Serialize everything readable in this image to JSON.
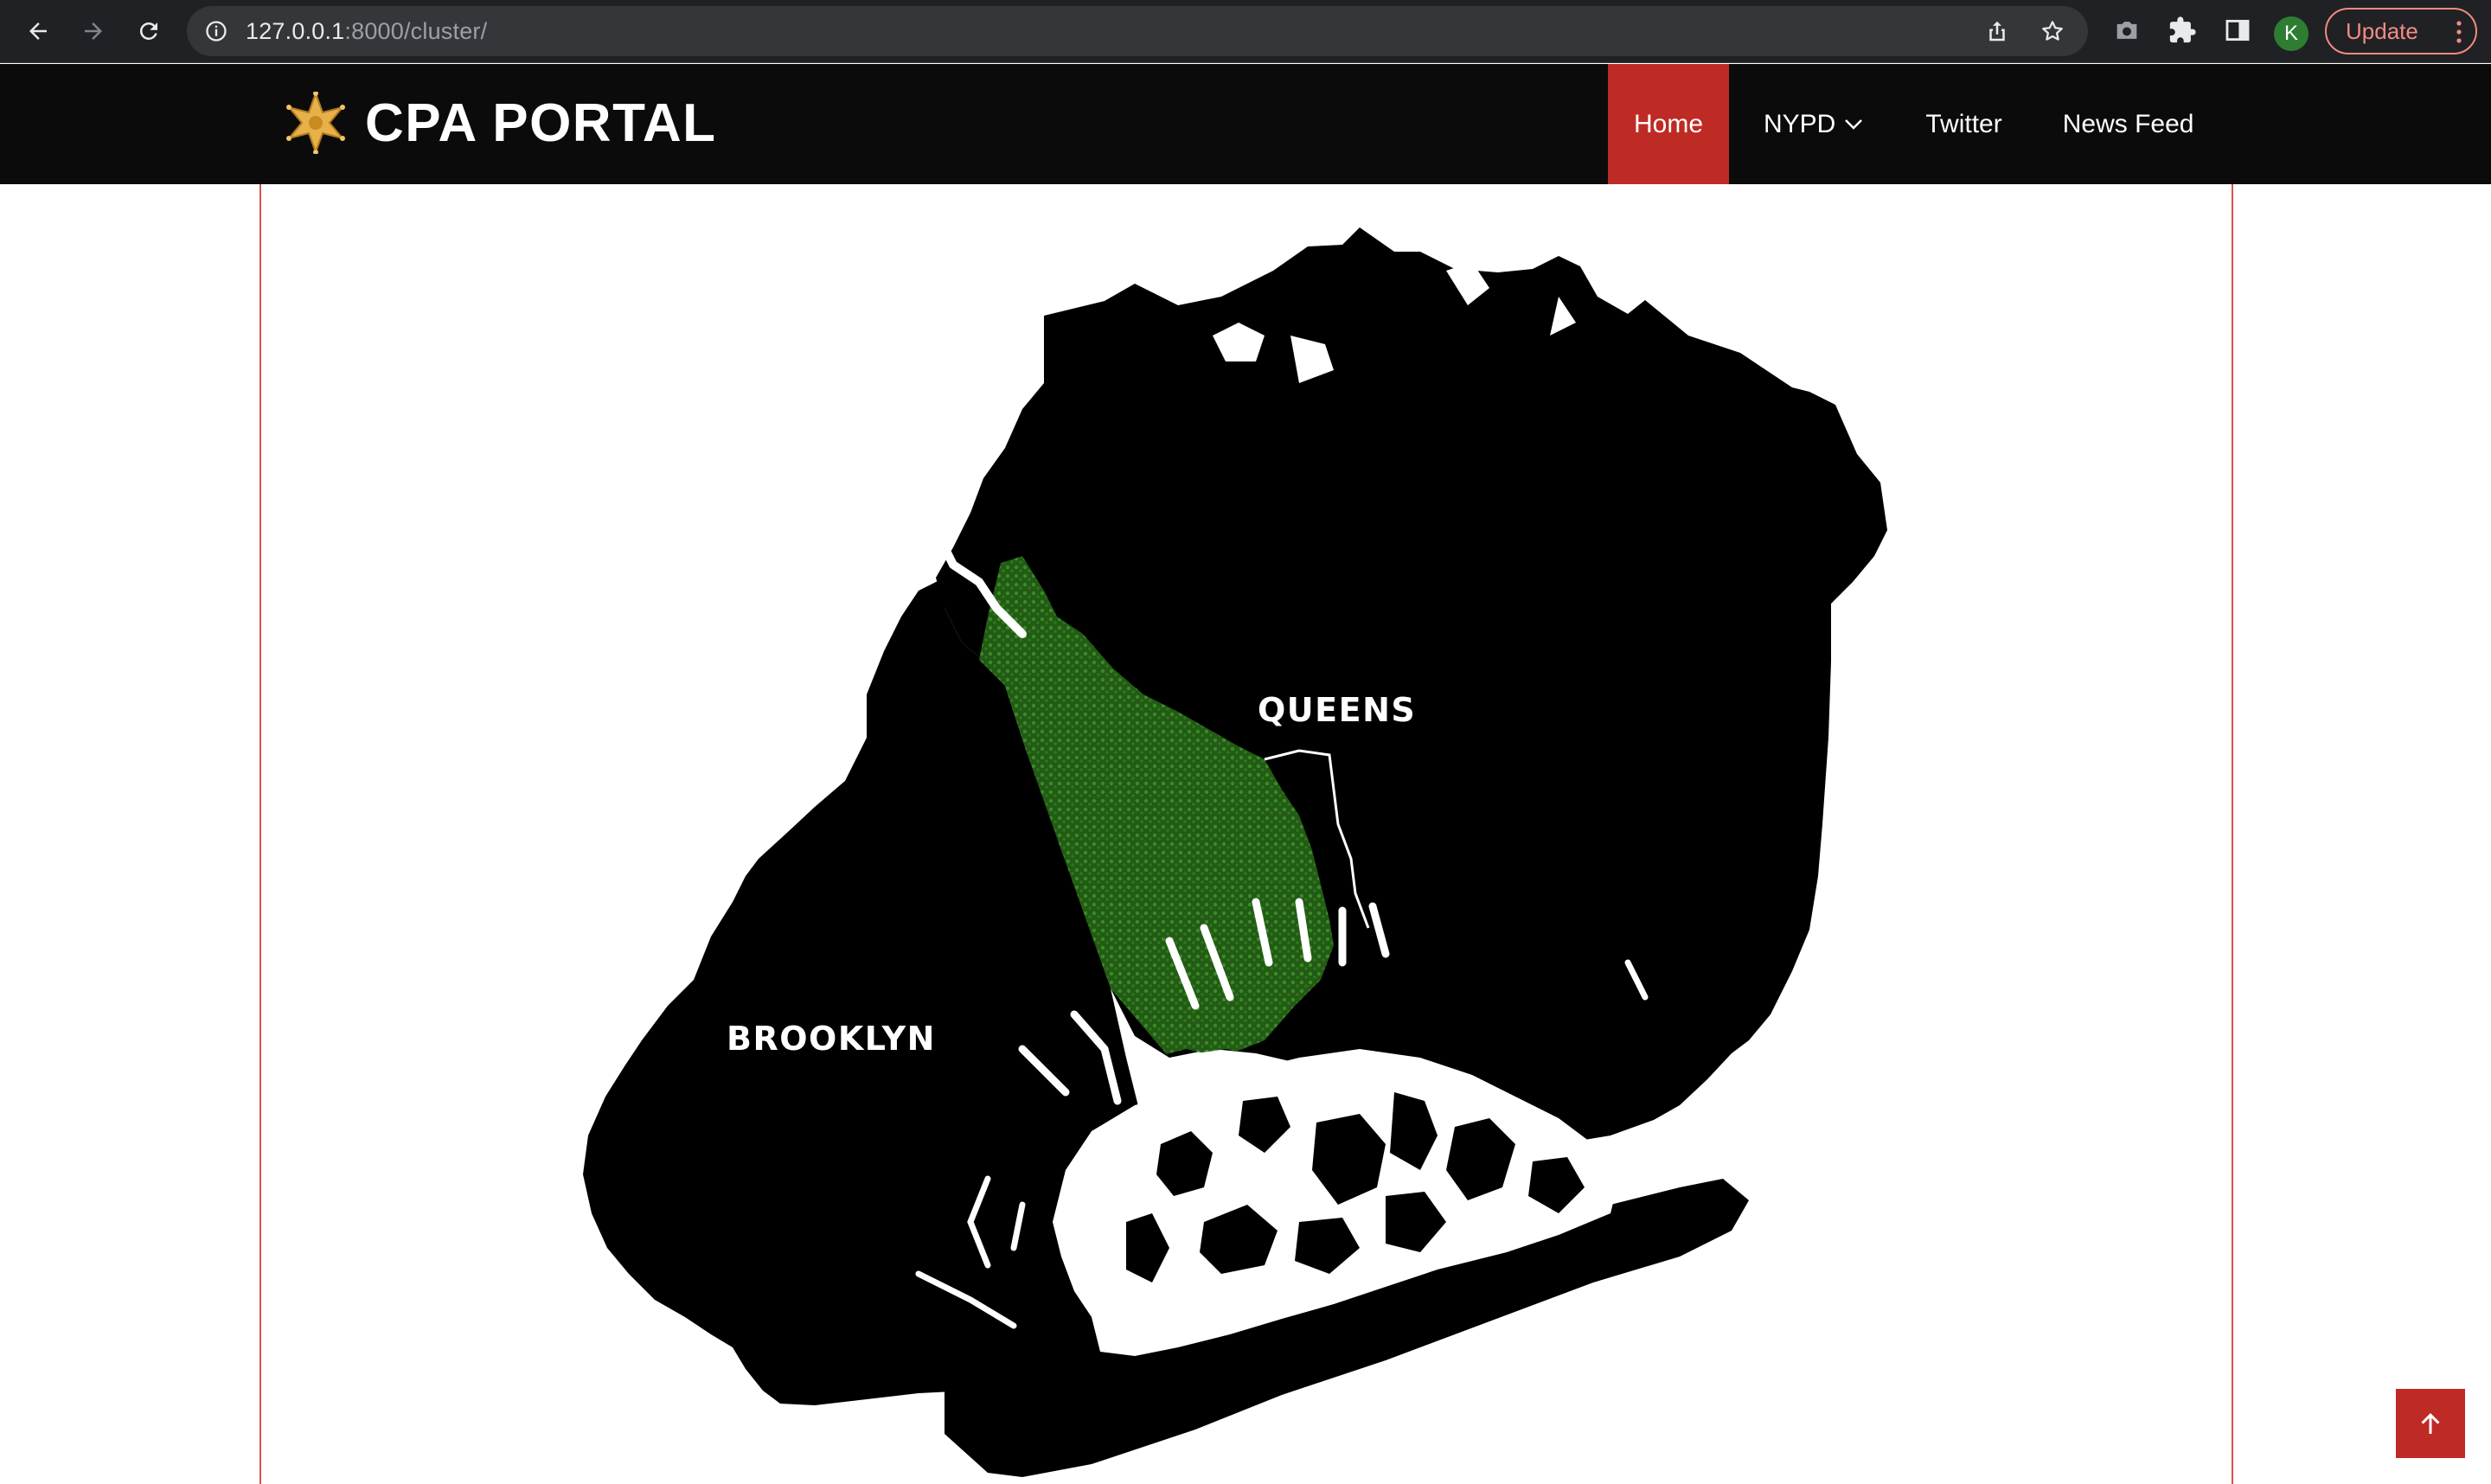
{
  "browser": {
    "url_host": "127.0.0.1",
    "url_rest": ":8000/cluster/",
    "profile_initial": "K",
    "update_label": "Update",
    "icons": [
      "back-icon",
      "forward-icon",
      "reload-icon",
      "info-icon",
      "share-icon",
      "star-icon",
      "camera-icon",
      "puzzle-icon",
      "sidepanel-icon",
      "more-vert-icon"
    ]
  },
  "site": {
    "title": "CPA PORTAL",
    "logo_icon": "police-star-icon",
    "nav": [
      {
        "label": "Home",
        "active": true
      },
      {
        "label": "NYPD",
        "dropdown": true
      },
      {
        "label": "Twitter"
      },
      {
        "label": "News Feed"
      }
    ]
  },
  "map": {
    "labels": {
      "queens": "QUEENS",
      "brooklyn": "BROOKLYN"
    },
    "colors": {
      "land": "#000000",
      "water": "#ffffff",
      "cluster": "#2f7d1e",
      "accent": "#be2a24"
    }
  },
  "back_to_top_icon": "arrow-up-icon"
}
